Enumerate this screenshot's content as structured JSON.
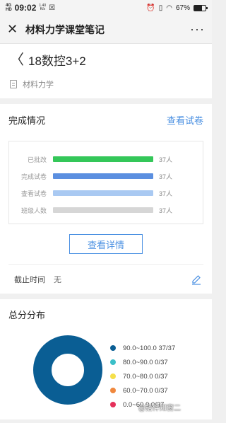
{
  "status_bar": {
    "network": "4G",
    "network_sub": "HD",
    "time": "09:02",
    "speed_value": "1.40",
    "speed_unit": "K/s",
    "battery": "67%",
    "battery_level": 0.67
  },
  "nav": {
    "title": "材料力学课堂笔记",
    "close_icon": "close-icon",
    "more_icon": "more-icon"
  },
  "header": {
    "title": "18数控3+2",
    "subject": "材料力学"
  },
  "completion": {
    "heading": "完成情况",
    "link": "查看试卷",
    "bars": [
      {
        "label": "已批改",
        "count": "37人",
        "color": "#34c759"
      },
      {
        "label": "完成试卷",
        "count": "37人",
        "color": "#5b8fe0"
      },
      {
        "label": "查看试卷",
        "count": "37人",
        "color": "#a9c9f2"
      },
      {
        "label": "班级人数",
        "count": "37人",
        "color": "#d6d6d6"
      }
    ],
    "detail_button": "查看详情",
    "deadline_label": "截止时间",
    "deadline_value": "无"
  },
  "distribution": {
    "heading": "总分分布",
    "legend": [
      {
        "range": "90.0~100.0",
        "count": "37/37",
        "color": "#0a5e94"
      },
      {
        "range": "80.0~90.0",
        "count": "0/37",
        "color": "#3bbfc8"
      },
      {
        "range": "70.0~80.0",
        "count": "0/37",
        "color": "#f5e04a"
      },
      {
        "range": "60.0~70.0",
        "count": "0/37",
        "color": "#f0883e"
      },
      {
        "range": "0.0~60.0",
        "count": "0/37",
        "color": "#e5305a"
      }
    ],
    "watermark": "@搭伴知窗二"
  }
}
